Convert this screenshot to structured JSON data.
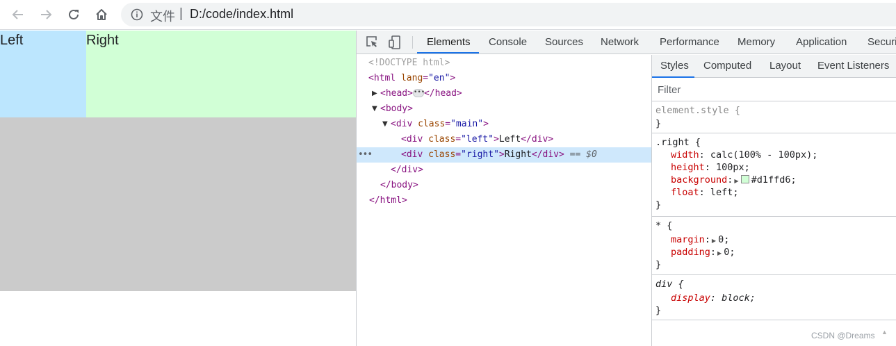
{
  "browser": {
    "scheme_label": "文件",
    "separator": "|",
    "url": "D:/code/index.html",
    "icons": [
      "back-arrow-icon",
      "forward-arrow-icon",
      "reload-icon",
      "home-icon",
      "info-icon"
    ]
  },
  "page": {
    "left_text": "Left",
    "right_text": "Right",
    "colors": {
      "left": "#bce6fe",
      "right": "#d1ffd6",
      "main": "#cbcbcb"
    }
  },
  "devtools": {
    "tabs": [
      "Elements",
      "Console",
      "Sources",
      "Network",
      "Performance",
      "Memory",
      "Application",
      "Securi"
    ],
    "active_tab": "Elements",
    "dom": {
      "doctype": "<!DOCTYPE html>",
      "html_open": "<html",
      "lang_attr": "lang",
      "lang_val": "\"en\"",
      "head_open": "<head>",
      "head_close": "</head>",
      "body_open": "<body>",
      "div_open": "<div",
      "class_attr": "class",
      "main_val": "\"main\"",
      "left_val": "\"left\"",
      "right_val": "\"right\"",
      "left_text": "Left",
      "right_text": "Right",
      "div_close": "</div>",
      "body_close": "</body>",
      "html_close": "</html>",
      "eq_marker": "== $0",
      "selected_marker": "•••"
    },
    "styles": {
      "tabs": [
        "Styles",
        "Computed",
        "Layout",
        "Event Listeners"
      ],
      "active_tab": "Styles",
      "filter_placeholder": "Filter",
      "rules": [
        {
          "selector": "element.style {",
          "close": "}",
          "declarations": []
        },
        {
          "selector": ".right {",
          "close": "}",
          "declarations": [
            {
              "prop": "width",
              "value": "calc(100% - 100px);"
            },
            {
              "prop": "height",
              "value": "100px;"
            },
            {
              "prop": "background",
              "value": "#d1ffd6;",
              "swatch": "#d1ffd6"
            },
            {
              "prop": "float",
              "value": "left;"
            }
          ]
        },
        {
          "selector": "* {",
          "close": "}",
          "declarations": [
            {
              "prop": "margin",
              "value": "0;"
            },
            {
              "prop": "padding",
              "value": "0;"
            }
          ]
        },
        {
          "selector": "div {",
          "close": "}",
          "declarations": [
            {
              "prop": "display",
              "value": "block;"
            }
          ]
        }
      ]
    }
  },
  "watermark": "CSDN @Dreams"
}
